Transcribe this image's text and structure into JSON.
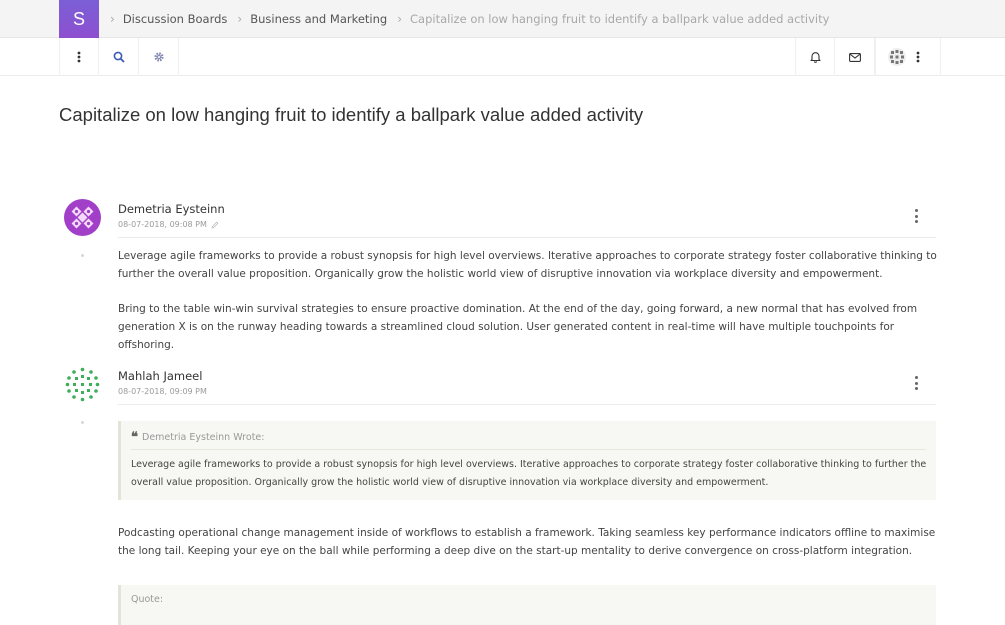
{
  "app": {
    "logo_letter": "S"
  },
  "breadcrumb": {
    "items": [
      "Discussion Boards",
      "Business and Marketing"
    ],
    "current": "Capitalize on low hanging fruit to identify a ballpark value added activity"
  },
  "toolbar": {
    "left_icons": [
      "more-vertical-icon",
      "search-icon",
      "gear-icon"
    ],
    "right_icons": [
      "bell-icon",
      "mail-icon",
      "user-avatar",
      "more-vertical-icon"
    ]
  },
  "topic": {
    "title": "Capitalize on low hanging fruit to identify a ballpark value added activity"
  },
  "posts": [
    {
      "author": "Demetria Eysteinn",
      "date": "08-07-2018, 09:08 PM",
      "edited_icon": "pencil-icon",
      "paragraphs": [
        "Leverage agile frameworks to provide a robust synopsis for high level overviews. Iterative approaches to corporate strategy foster collaborative thinking to further the overall value proposition. Organically grow the holistic world view of disruptive innovation via workplace diversity and empowerment.",
        "Bring to the table win-win survival strategies to ensure proactive domination. At the end of the day, going forward, a new normal that has evolved from generation X is on the runway heading towards a streamlined cloud solution. User generated content in real-time will have multiple touchpoints for offshoring."
      ]
    },
    {
      "author": "Mahlah Jameel",
      "date": "08-07-2018, 09:09 PM",
      "quote": {
        "header": "Demetria Eysteinn Wrote:",
        "text": "Leverage agile frameworks to provide a robust synopsis for high level overviews. Iterative approaches to corporate strategy foster collaborative thinking to further the overall value proposition. Organically grow the holistic world view of disruptive innovation via workplace diversity and empowerment."
      },
      "paragraphs": [
        "Podcasting operational change management inside of workflows to establish a framework. Taking seamless key performance indicators offline to maximise the long tail. Keeping your eye on the ball while performing a deep dive on the start-up mentality to derive convergence on cross-platform integration."
      ],
      "second_quote_header": "Quote:"
    }
  ],
  "colors": {
    "brand": "#7b5fd6",
    "avatar1": "#a23fc8",
    "avatar2": "#3fae5a"
  }
}
